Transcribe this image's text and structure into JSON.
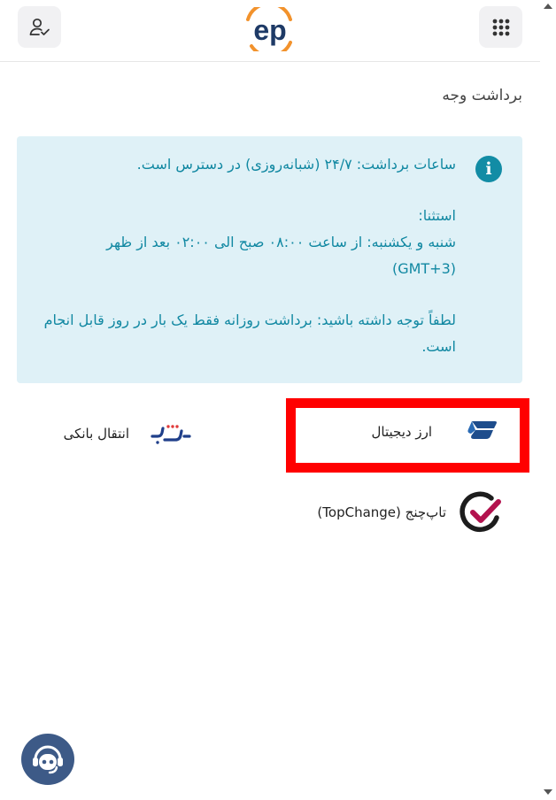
{
  "header": {
    "logo_text": "ep",
    "user_icon": "user-check-icon",
    "menu_icon": "grid-menu-icon"
  },
  "page": {
    "title": "برداشت وجه"
  },
  "info": {
    "icon": "info-icon",
    "line1": "ساعات برداشت: ۲۴/۷ (شبانه‌روزی) در دسترس است.",
    "exception_title": "استثنا:",
    "exception_text": "شنبه و یکشنبه: از ساعت ۰۸:۰۰ صبح الی ۰۲:۰۰ بعد از ظهر (GMT+3)",
    "note": "لطفاً توجه داشته باشید: برداشت روزانه فقط یک بار در روز قابل انجام است."
  },
  "methods": [
    {
      "label": "ارز دیجیتال",
      "icon": "crypto-icon"
    },
    {
      "label": "انتقال بانکی",
      "icon": "shaba-icon"
    },
    {
      "label": "تاپ‌چنج (TopChange)",
      "icon": "topchange-icon"
    }
  ],
  "support": {
    "icon": "support-bot-icon"
  },
  "colors": {
    "accent": "#128ca5",
    "info_bg": "#dff1f7",
    "logo_blue": "#1e3a66",
    "logo_orange": "#f2922c",
    "highlight": "#ff0000",
    "support_bg": "#3d5a87"
  }
}
